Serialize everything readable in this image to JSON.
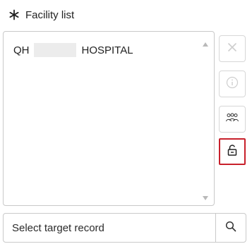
{
  "field": {
    "label": "Facility list",
    "required_icon": "asterisk-icon"
  },
  "list": {
    "items": [
      {
        "prefix": "QH",
        "suffix": "HOSPITAL",
        "redacted": true
      }
    ],
    "scroll_up_icon": "triangle-up-icon",
    "scroll_down_icon": "triangle-down-icon"
  },
  "side_buttons": [
    {
      "icon": "close-icon",
      "state": "disabled"
    },
    {
      "icon": "info-icon",
      "state": "disabled"
    },
    {
      "icon": "group-icon",
      "state": "enabled"
    },
    {
      "icon": "unlock-icon",
      "state": "highlighted"
    }
  ],
  "search": {
    "placeholder": "Select target record",
    "value": "",
    "button_icon": "search-icon"
  },
  "colors": {
    "border": "#c9c9c9",
    "highlight": "#c8202b",
    "disabled_icon": "#c9c9c9",
    "text": "#222222"
  }
}
